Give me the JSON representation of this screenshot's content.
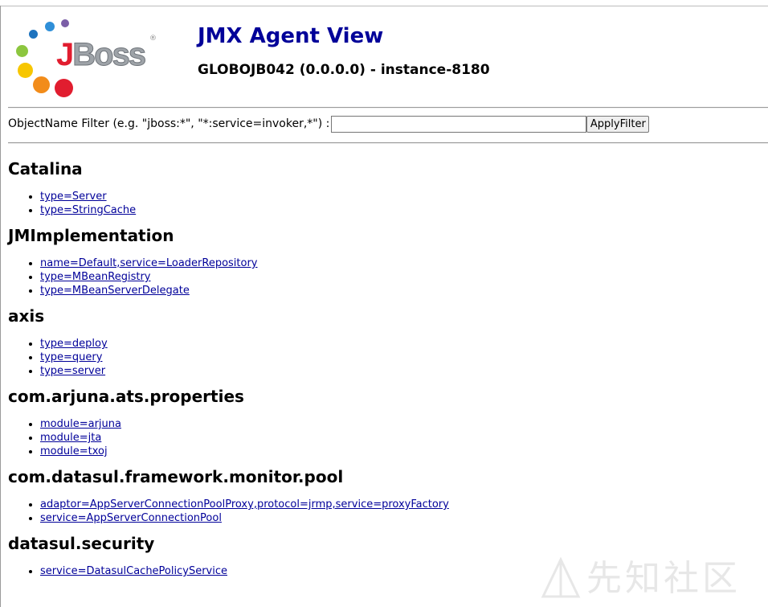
{
  "header": {
    "logo_text_j": "J",
    "logo_text_boss": "Boss",
    "logo_reg": "®",
    "title": "JMX Agent View",
    "server_info": "GLOBOJB042 (0.0.0.0) - instance-8180"
  },
  "filter": {
    "label": "ObjectName Filter (e.g. \"jboss:*\", \"*:service=invoker,*\") :",
    "value": "",
    "placeholder": "",
    "button_label": "ApplyFilter"
  },
  "domains": [
    {
      "name": "Catalina",
      "mbeans": [
        "type=Server",
        "type=StringCache"
      ]
    },
    {
      "name": "JMImplementation",
      "mbeans": [
        "name=Default,service=LoaderRepository",
        "type=MBeanRegistry",
        "type=MBeanServerDelegate"
      ]
    },
    {
      "name": "axis",
      "mbeans": [
        "type=deploy",
        "type=query",
        "type=server"
      ]
    },
    {
      "name": "com.arjuna.ats.properties",
      "mbeans": [
        "module=arjuna",
        "module=jta",
        "module=txoj"
      ]
    },
    {
      "name": "com.datasul.framework.monitor.pool",
      "mbeans": [
        "adaptor=AppServerConnectionPoolProxy,protocol=jrmp,service=proxyFactory",
        "service=AppServerConnectionPool"
      ]
    },
    {
      "name": "datasul.security",
      "mbeans": [
        "service=DatasulCachePolicyService"
      ]
    }
  ],
  "watermark": {
    "text": "先知社区"
  },
  "colors": {
    "title": "#000099",
    "link": "#000099",
    "logo_j": "#e11d2f",
    "logo_boss": "#9ea3a8"
  }
}
